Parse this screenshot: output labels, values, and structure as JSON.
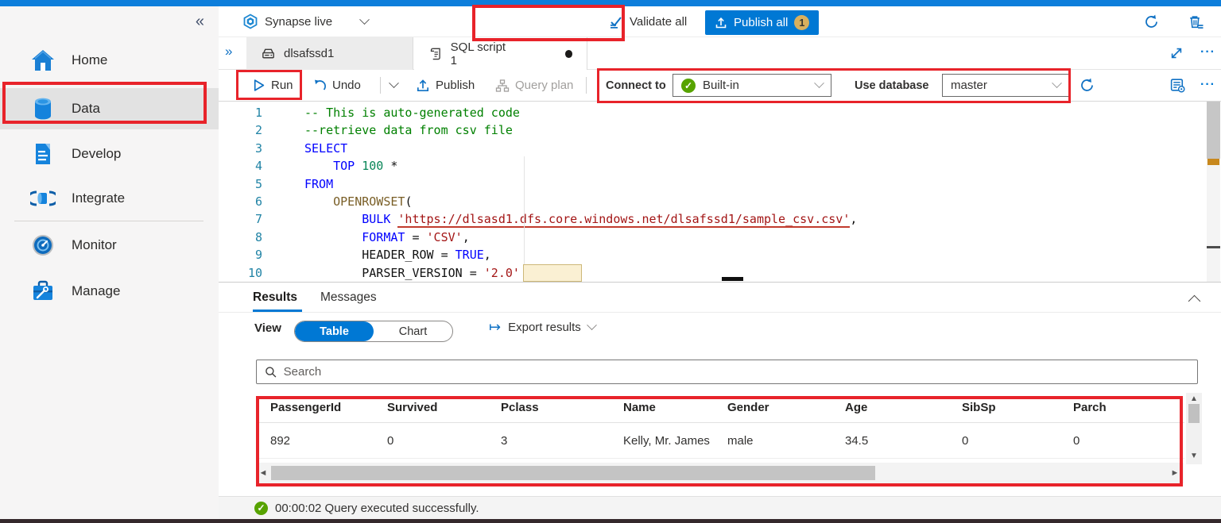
{
  "command_bar": {
    "mode_label": "Synapse live",
    "validate_label": "Validate all",
    "publish_label": "Publish all",
    "publish_badge": "1"
  },
  "sidebar": {
    "items": [
      {
        "label": "Home",
        "icon": "home-icon"
      },
      {
        "label": "Data",
        "icon": "database-icon",
        "selected": true
      },
      {
        "label": "Develop",
        "icon": "develop-icon"
      },
      {
        "label": "Integrate",
        "icon": "integrate-icon"
      },
      {
        "label": "Monitor",
        "icon": "monitor-icon"
      },
      {
        "label": "Manage",
        "icon": "manage-icon"
      }
    ]
  },
  "tabs": [
    {
      "label": "dlsafssd1",
      "icon": "storage-icon",
      "active": false
    },
    {
      "label": "SQL script 1",
      "icon": "sql-script-icon",
      "active": true,
      "dirty": true
    }
  ],
  "toolbar": {
    "run_label": "Run",
    "undo_label": "Undo",
    "publish_label": "Publish",
    "query_plan_label": "Query plan",
    "connect_to_label": "Connect to",
    "connect_to_value": "Built-in",
    "use_database_label": "Use database",
    "use_database_value": "master"
  },
  "editor": {
    "lines": [
      {
        "num": "1",
        "tokens": [
          {
            "t": "-- This is auto-generated code",
            "c": "cm"
          }
        ]
      },
      {
        "num": "2",
        "tokens": [
          {
            "t": "--retrieve data from csv file",
            "c": "cm"
          }
        ]
      },
      {
        "num": "3",
        "tokens": [
          {
            "t": "SELECT",
            "c": "kw"
          }
        ]
      },
      {
        "num": "4",
        "tokens": [
          {
            "t": "    ",
            "c": "pl"
          },
          {
            "t": "TOP",
            "c": "kw"
          },
          {
            "t": " ",
            "c": "pl"
          },
          {
            "t": "100",
            "c": "nm"
          },
          {
            "t": " *",
            "c": "pl"
          }
        ]
      },
      {
        "num": "5",
        "tokens": [
          {
            "t": "FROM",
            "c": "kw"
          }
        ]
      },
      {
        "num": "6",
        "tokens": [
          {
            "t": "    ",
            "c": "pl"
          },
          {
            "t": "OPENROWSET",
            "c": "fn"
          },
          {
            "t": "(",
            "c": "pl"
          }
        ]
      },
      {
        "num": "7",
        "tokens": [
          {
            "t": "        ",
            "c": "pl"
          },
          {
            "t": "BULK",
            "c": "kw"
          },
          {
            "t": " ",
            "c": "pl"
          },
          {
            "t": "'https://dlsasd1.dfs.core.windows.net/dlsafssd1/sample_csv.csv'",
            "c": "stu"
          },
          {
            "t": ",",
            "c": "pl"
          }
        ]
      },
      {
        "num": "8",
        "tokens": [
          {
            "t": "        ",
            "c": "pl"
          },
          {
            "t": "FORMAT",
            "c": "kw"
          },
          {
            "t": " = ",
            "c": "pl"
          },
          {
            "t": "'CSV'",
            "c": "st"
          },
          {
            "t": ",",
            "c": "pl"
          }
        ]
      },
      {
        "num": "9",
        "tokens": [
          {
            "t": "        ",
            "c": "pl"
          },
          {
            "t": "HEADER_ROW",
            "c": "pl"
          },
          {
            "t": " = ",
            "c": "pl"
          },
          {
            "t": "TRUE",
            "c": "kw"
          },
          {
            "t": ",",
            "c": "pl"
          }
        ]
      },
      {
        "num": "10",
        "tokens": [
          {
            "t": "        ",
            "c": "pl"
          },
          {
            "t": "PARSER_VERSION",
            "c": "pl"
          },
          {
            "t": " = ",
            "c": "pl"
          },
          {
            "t": "'2.0'",
            "c": "st"
          }
        ]
      }
    ]
  },
  "results_panel": {
    "tabs": [
      "Results",
      "Messages"
    ],
    "active_tab": "Results",
    "view_label": "View",
    "view_options": [
      "Table",
      "Chart"
    ],
    "selected_view": "Table",
    "export_label": "Export results",
    "search_placeholder": "Search"
  },
  "results_table": {
    "headers": [
      "PassengerId",
      "Survived",
      "Pclass",
      "Name",
      "Gender",
      "Age",
      "SibSp",
      "Parch"
    ],
    "rows": [
      [
        "892",
        "0",
        "3",
        "Kelly, Mr. James",
        "male",
        "34.5",
        "0",
        "0"
      ]
    ]
  },
  "status_bar": {
    "message": "00:00:02 Query executed successfully."
  },
  "icons": {
    "collapse": "«",
    "expand_tabs": "»",
    "more": "···",
    "up_arrow": "▲",
    "down_arrow": "▼",
    "left_arrow": "◄",
    "right_arrow": "►",
    "export_arrow": "↦"
  },
  "colors": {
    "accent": "#0078d4",
    "annotation_red": "#e8232a",
    "success_green": "#57a300",
    "badge_gold": "#d9b05e"
  }
}
